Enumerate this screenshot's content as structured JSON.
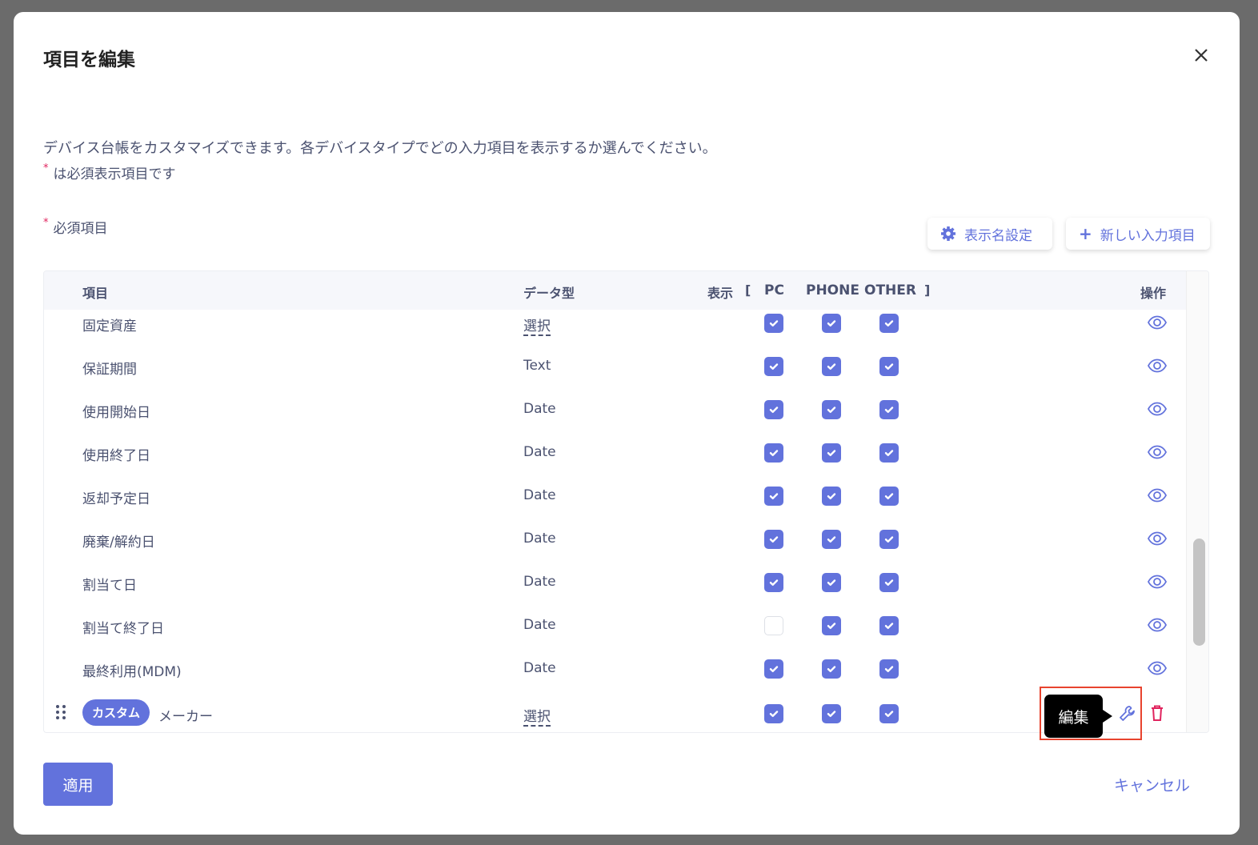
{
  "dialog": {
    "title": "項目を編集",
    "description": "デバイス台帳をカスタマイズできます。各デバイスタイプでどの入力項目を表示するか選んでください。",
    "required_note": "は必須表示項目です",
    "required_marker": "*",
    "section_label": "必須項目"
  },
  "toolbar": {
    "display_name_settings": "表示名設定",
    "new_field": "新しい入力項目",
    "plus": "+"
  },
  "table": {
    "headers": {
      "item": "項目",
      "data_type": "データ型",
      "display": "表示",
      "bracket_open": "[",
      "pc": "PC",
      "phone": "PHONE",
      "other": "OTHER",
      "bracket_close": "]",
      "actions": "操作"
    },
    "rows": [
      {
        "name": "固定資産",
        "type": "選択",
        "pc": true,
        "phone": true,
        "other": true
      },
      {
        "name": "保証期間",
        "type": "Text",
        "pc": true,
        "phone": true,
        "other": true
      },
      {
        "name": "使用開始日",
        "type": "Date",
        "pc": true,
        "phone": true,
        "other": true
      },
      {
        "name": "使用終了日",
        "type": "Date",
        "pc": true,
        "phone": true,
        "other": true
      },
      {
        "name": "返却予定日",
        "type": "Date",
        "pc": true,
        "phone": true,
        "other": true
      },
      {
        "name": "廃棄/解約日",
        "type": "Date",
        "pc": true,
        "phone": true,
        "other": true
      },
      {
        "name": "割当て日",
        "type": "Date",
        "pc": true,
        "phone": true,
        "other": true
      },
      {
        "name": "割当て終了日",
        "type": "Date",
        "pc": false,
        "phone": true,
        "other": true
      },
      {
        "name": "最終利用(MDM)",
        "type": "Date",
        "pc": true,
        "phone": true,
        "other": true
      }
    ],
    "custom_row": {
      "badge": "カスタム",
      "name": "メーカー",
      "type": "選択",
      "pc": true,
      "phone": true,
      "other": true
    }
  },
  "tooltip": "編集",
  "footer": {
    "apply": "適用",
    "cancel": "キャンセル"
  },
  "colors": {
    "accent": "#6272dc",
    "danger": "#e0245e"
  }
}
